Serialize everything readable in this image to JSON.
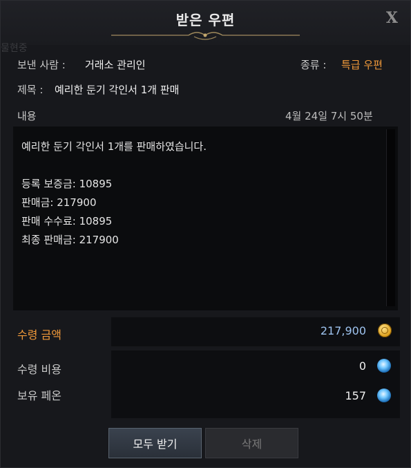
{
  "window": {
    "title": "받은 우편",
    "close_label": "X",
    "bg_tag": "물현중"
  },
  "mail": {
    "sender_label": "보낸 사람 :",
    "sender_value": "거래소 관리인",
    "type_label": "종류 :",
    "type_value": "특급 우편",
    "subject_label": "제목 :",
    "subject_value": "예리한 둔기 각인서 1개 판매",
    "content_label": "내용",
    "date": "4월 24일 7시 50분",
    "body": "예리한 둔기 각인서 1개를 판매하였습니다.\n\n등록 보증금: 10895\n판매금: 217900\n판매 수수료: 10895\n최종 판매금: 217900"
  },
  "receive": {
    "label": "수령 금액",
    "value": "217,900",
    "icon": "gold-coin-icon"
  },
  "cost": {
    "label": "수령 비용",
    "value": "0",
    "icon": "pheon-icon"
  },
  "owned": {
    "label": "보유 페온",
    "value": "157",
    "icon": "pheon-icon"
  },
  "buttons": {
    "receive_all": "모두 받기",
    "delete": "삭제"
  },
  "colors": {
    "accent_orange": "#f29a3a",
    "amount_blue": "#9ec3ef",
    "background": "#17181c"
  }
}
